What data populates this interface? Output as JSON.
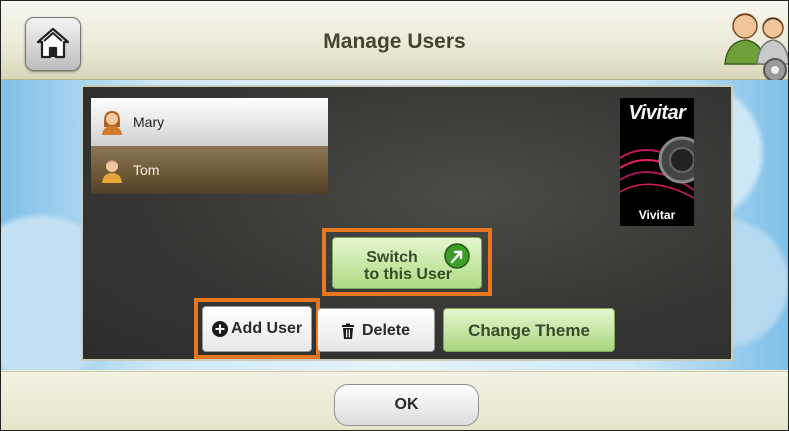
{
  "header": {
    "title": "Manage Users",
    "home_icon": "home-icon",
    "users_icon": "users-gear-icon"
  },
  "users": [
    {
      "name": "Mary",
      "icon": "female-user-icon",
      "selected": false
    },
    {
      "name": "Tom",
      "icon": "male-user-icon",
      "selected": true
    }
  ],
  "theme": {
    "brand": "Vivitar",
    "caption": "Vivitar"
  },
  "buttons": {
    "switch_line1": "Switch",
    "switch_line2": "to this User",
    "switch_icon": "go-arrow-icon",
    "add_user": "Add User",
    "add_icon": "plus-circle-icon",
    "delete": "Delete",
    "delete_icon": "trash-icon",
    "change_theme": "Change Theme"
  },
  "footer": {
    "ok": "OK"
  },
  "colors": {
    "highlight_outline": "#e9771f",
    "green_button": "#aedb83",
    "title_text": "#45452f"
  }
}
